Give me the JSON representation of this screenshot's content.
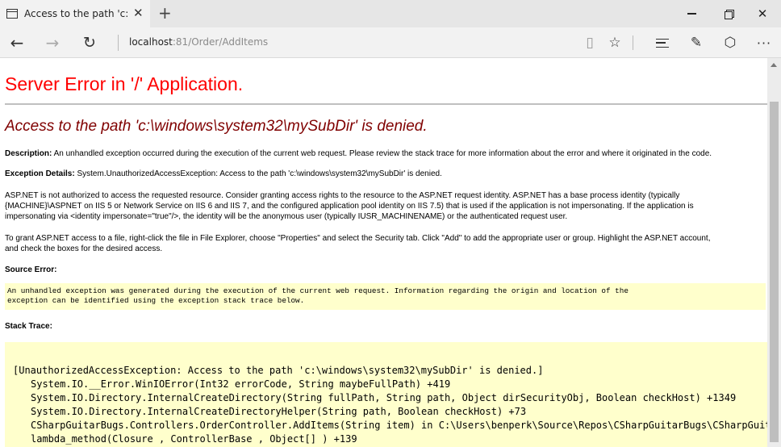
{
  "browser": {
    "tab_title": "Access to the path 'c:\\wi",
    "tab_close_glyph": "✕",
    "new_tab_glyph": "+",
    "window": {
      "close_glyph": "✕"
    },
    "nav": {
      "back_glyph": "←",
      "forward_glyph": "→",
      "refresh_glyph": "↻"
    },
    "address": {
      "host": "localhost",
      "rest": ":81/Order/AddItems"
    },
    "toolbar": {
      "reading_glyph": "▯",
      "favorite_glyph": "☆",
      "note_glyph": "✎",
      "share_glyph": "⬡",
      "more_glyph": "···"
    }
  },
  "page": {
    "heading": "Server Error in '/' Application.",
    "error_title": "Access to the path 'c:\\windows\\system32\\mySubDir' is denied.",
    "description": {
      "label": "Description:",
      "text": " An unhandled exception occurred during the execution of the current web request. Please review the stack trace for more information about the error and where it originated in the code."
    },
    "exception_details": {
      "label": "Exception Details:",
      "text": " System.UnauthorizedAccessException: Access to the path 'c:\\windows\\system32\\mySubDir' is denied."
    },
    "aspnet_paragraph": [
      "ASP.NET is not authorized to access the requested resource. Consider granting access rights to the resource to the ASP.NET request identity. ASP.NET has a base process identity (typically",
      "{MACHINE}\\ASPNET on IIS 5 or Network Service on IIS 6 and IIS 7, and the configured application pool identity on IIS 7.5) that is used if the application is not impersonating. If the application is",
      "impersonating via <identity impersonate=\"true\"/>, the identity will be the anonymous user (typically IUSR_MACHINENAME) or the authenticated request user."
    ],
    "grant_paragraph": [
      "To grant ASP.NET access to a file, right-click the file in File Explorer, choose \"Properties\" and select the Security tab. Click \"Add\" to add the appropriate user or group. Highlight the ASP.NET account,",
      "and check the boxes for the desired access."
    ],
    "source_error_heading": "Source Error:",
    "source_error_text": [
      "An unhandled exception was generated during the execution of the current web request. Information regarding the origin and location of the",
      "exception can be identified using the exception stack trace below."
    ],
    "stack_trace_heading": "Stack Trace:",
    "stack_trace": [
      "[UnauthorizedAccessException: Access to the path 'c:\\windows\\system32\\mySubDir' is denied.]",
      "System.IO.__Error.WinIOError(Int32 errorCode, String maybeFullPath) +419",
      "System.IO.Directory.InternalCreateDirectory(String fullPath, String path, Object dirSecurityObj, Boolean checkHost) +1349",
      "System.IO.Directory.InternalCreateDirectoryHelper(String path, Boolean checkHost) +73",
      "CSharpGuitarBugs.Controllers.OrderController.AddItems(String item) in C:\\Users\\benperk\\Source\\Repos\\CSharpGuitarBugs\\CSharpGuitarBugs",
      "lambda_method(Closure , ControllerBase , Object[] ) +139"
    ]
  }
}
